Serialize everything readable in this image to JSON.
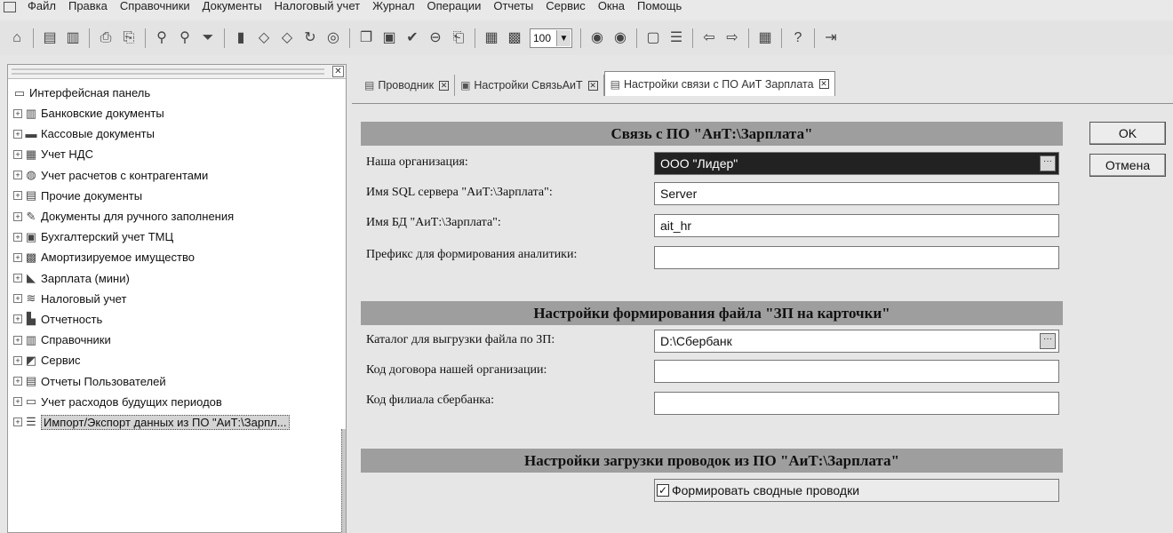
{
  "menu": {
    "items": [
      "Файл",
      "Правка",
      "Справочники",
      "Документы",
      "Налоговый учет",
      "Журнал",
      "Операции",
      "Отчеты",
      "Сервис",
      "Окна",
      "Помощь"
    ]
  },
  "toolbar": {
    "zoom_value": "100",
    "icons": [
      "home-icon",
      "doc-icon",
      "doc2-icon",
      "print-icon",
      "print-preview-icon",
      "search-icon",
      "find-next-icon",
      "filter-icon",
      "chart-icon",
      "tag-icon",
      "tag2-icon",
      "refresh-icon",
      "stop-icon",
      "copy-icon",
      "paste-icon",
      "ok-icon",
      "minus-icon",
      "export-icon",
      "calc-icon",
      "calendar-icon",
      "circle-icon",
      "circle2-icon",
      "save-icon",
      "list-icon",
      "back-icon",
      "forward-icon",
      "calculator-icon",
      "help-icon",
      "exit-icon"
    ]
  },
  "left_panel": {
    "root_label": "Интерфейсная панель",
    "items": [
      {
        "label": "Банковские документы",
        "icon": "bank-icon"
      },
      {
        "label": "Кассовые документы",
        "icon": "cash-icon"
      },
      {
        "label": "Учет НДС",
        "icon": "vat-icon"
      },
      {
        "label": "Учет расчетов с контрагентами",
        "icon": "contractors-icon"
      },
      {
        "label": "Прочие документы",
        "icon": "documents-icon"
      },
      {
        "label": "Документы для ручного заполнения",
        "icon": "pen-icon"
      },
      {
        "label": "Бухгалтерский учет ТМЦ",
        "icon": "inventory-icon"
      },
      {
        "label": "Амортизируемое имущество",
        "icon": "property-icon"
      },
      {
        "label": "Зарплата (мини)",
        "icon": "salary-icon"
      },
      {
        "label": "Налоговый учет",
        "icon": "tax-icon"
      },
      {
        "label": "Отчетность",
        "icon": "reports-icon"
      },
      {
        "label": "Справочники",
        "icon": "directories-icon"
      },
      {
        "label": "Сервис",
        "icon": "service-icon"
      },
      {
        "label": "Отчеты Пользователей",
        "icon": "user-reports-icon"
      },
      {
        "label": "Учет расходов будущих периодов",
        "icon": "future-costs-icon"
      },
      {
        "label": "Импорт/Экспорт данных из ПО \"АиТ:\\Зарпл...",
        "icon": "import-export-icon"
      }
    ]
  },
  "tabs": [
    {
      "label": "Проводник"
    },
    {
      "label": "Настройки СвязьАиТ"
    },
    {
      "label": "Настройки связи с ПО АиТ Зарплата"
    }
  ],
  "form": {
    "section1_title": "Связь с ПО \"АнТ:\\Зарплата\"",
    "org_label": "Наша организация:",
    "org_value": "ООО \"Лидер\"",
    "sql_label": "Имя SQL сервера \"АиТ:\\Зарплата\":",
    "sql_value": "Server",
    "db_label": "Имя БД \"АиТ:\\Зарплата\":",
    "db_value": "ait_hr",
    "prefix_label": "Префикс для формирования аналитики:",
    "prefix_value": "",
    "section2_title": "Настройки формирования файла \"ЗП на карточки\"",
    "catalog_label": "Каталог для выгрузки файла по ЗП:",
    "catalog_value": "D:\\Сбербанк",
    "contract_label": "Код договора нашей организации:",
    "contract_value": "",
    "branch_label": "Код филиала сбербанка:",
    "branch_value": "",
    "section3_title": "Настройки загрузки проводок из ПО \"АиТ:\\Зарплата\"",
    "checkbox_label": "Формировать сводные проводки",
    "checkbox_checked": true
  },
  "buttons": {
    "ok": "OK",
    "cancel": "Отмена"
  }
}
